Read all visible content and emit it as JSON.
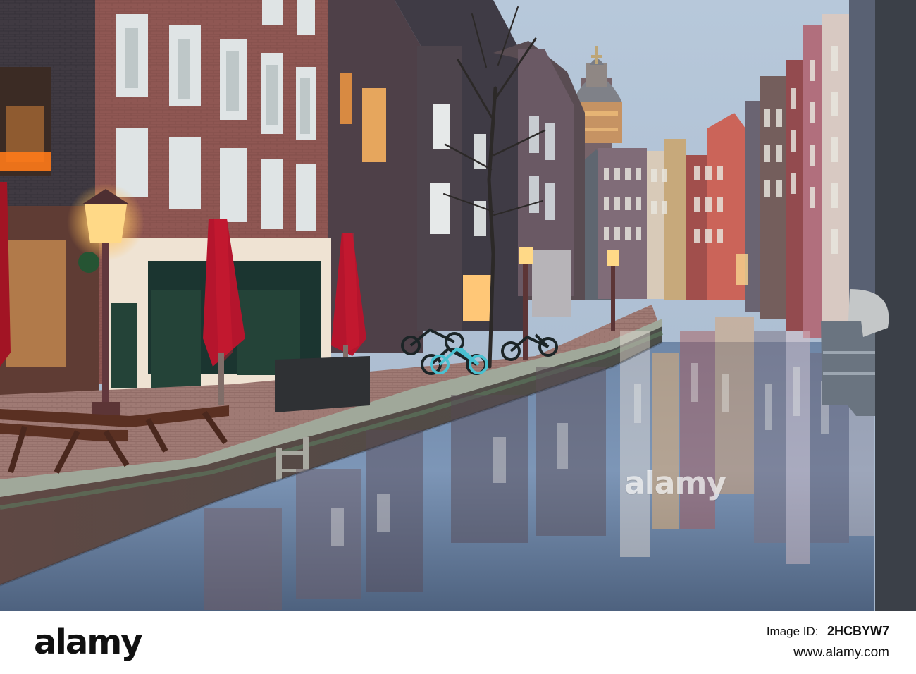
{
  "scene": {
    "main_watermark": "alamy"
  },
  "footer": {
    "logo_text": "alamy",
    "image_id_label": "Image ID:",
    "image_id": "2HCBYW7",
    "website": "www.alamy.com"
  },
  "colors": {
    "sky": "#B9C9D9",
    "water": "#758BAA",
    "lamp": "#FFD27A",
    "umbrella": "#B5152D",
    "brick": "#8B514C",
    "quay": "#8A6A67"
  },
  "icons": {
    "watermark": "text-watermark",
    "scene": "canal-photo"
  }
}
